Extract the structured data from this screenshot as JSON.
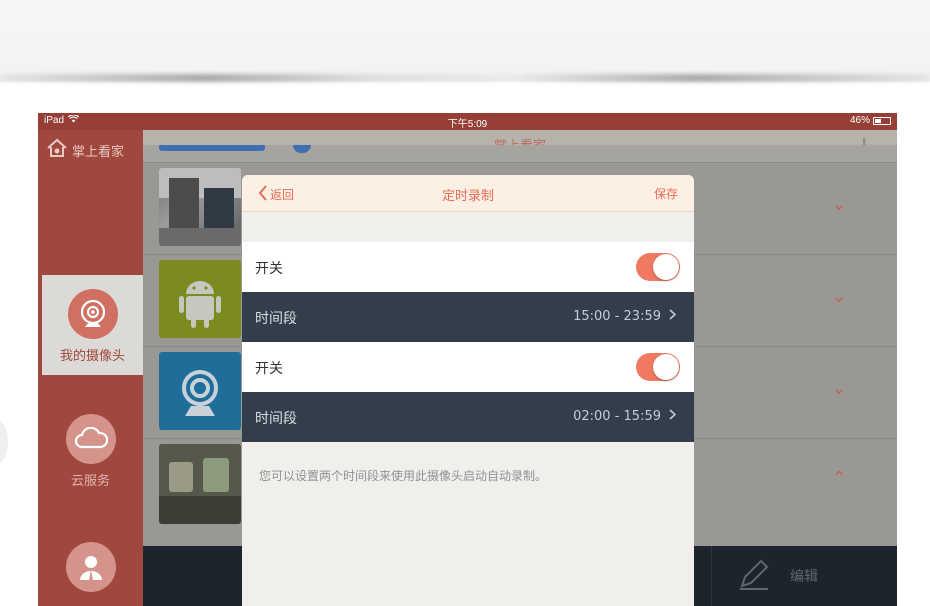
{
  "status_bar": {
    "device": "iPad",
    "time": "下午5:09",
    "battery": "46%",
    "battery_level": 0.46
  },
  "app": {
    "logo_text": "掌上看家",
    "header_title": "掌上看家",
    "add_button": "+"
  },
  "sidebar": {
    "items": [
      {
        "label": "我的摄像头",
        "icon": "camera-icon",
        "active": true
      },
      {
        "label": "云服务",
        "icon": "cloud-icon",
        "active": false
      },
      {
        "label": "",
        "icon": "user-icon",
        "active": false
      }
    ]
  },
  "camera_list": {
    "rows": [
      {
        "thumb": "office-camera-thumbnail",
        "chevron": "chevron-down-icon"
      },
      {
        "thumb": "android-icon",
        "chevron": "chevron-down-icon"
      },
      {
        "thumb": "webcam-icon",
        "chevron": "chevron-down-icon"
      },
      {
        "thumb": "desk-cups-thumbnail",
        "chevron": "chevron-up-icon"
      }
    ]
  },
  "bottom_bar": {
    "edit_label": "编辑"
  },
  "modal": {
    "back_label": "返回",
    "title": "定时录制",
    "save_label": "保存",
    "schedules": [
      {
        "switch_label": "开关",
        "enabled": true,
        "period_label": "时间段",
        "period_value": "15:00 - 23:59"
      },
      {
        "switch_label": "开关",
        "enabled": true,
        "period_label": "时间段",
        "period_value": "02:00 - 15:59"
      }
    ],
    "hint": "您可以设置两个时间段来使用此摄像头启动自动录制。"
  },
  "colors": {
    "accent": "#e96c55",
    "sidebar": "#a0473e",
    "status_bar": "#953f37",
    "dark_row": "#333e4d",
    "toggle_on": "#f07a61"
  }
}
